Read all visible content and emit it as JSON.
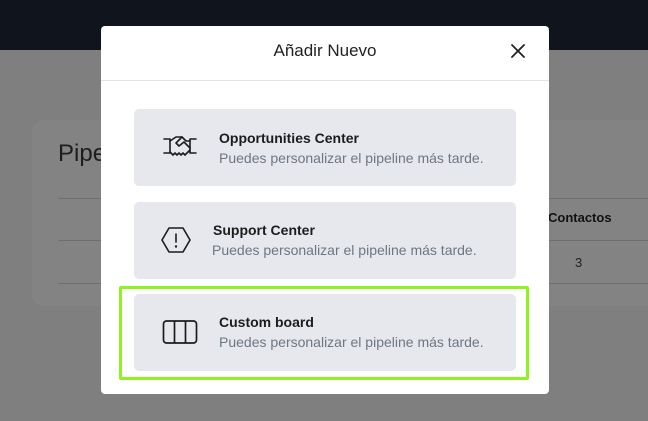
{
  "background": {
    "page_title": "Pipe",
    "column_header": "Contactos",
    "cell_value": "3"
  },
  "modal": {
    "title": "Añadir Nuevo",
    "close_icon": "close-icon",
    "options": [
      {
        "title": "Opportunities Center",
        "description": "Puedes personalizar el pipeline más tarde.",
        "icon": "handshake-icon"
      },
      {
        "title": "Support Center",
        "description": "Puedes personalizar el pipeline más tarde.",
        "icon": "alert-hexagon-icon"
      },
      {
        "title": "Custom board",
        "description": "Puedes personalizar el pipeline más tarde.",
        "icon": "columns-icon"
      }
    ]
  },
  "colors": {
    "highlight": "#8ff31f",
    "option_bg": "#e6e8ee",
    "overlay": "#7f7f7f",
    "topbar": "#10151d"
  }
}
